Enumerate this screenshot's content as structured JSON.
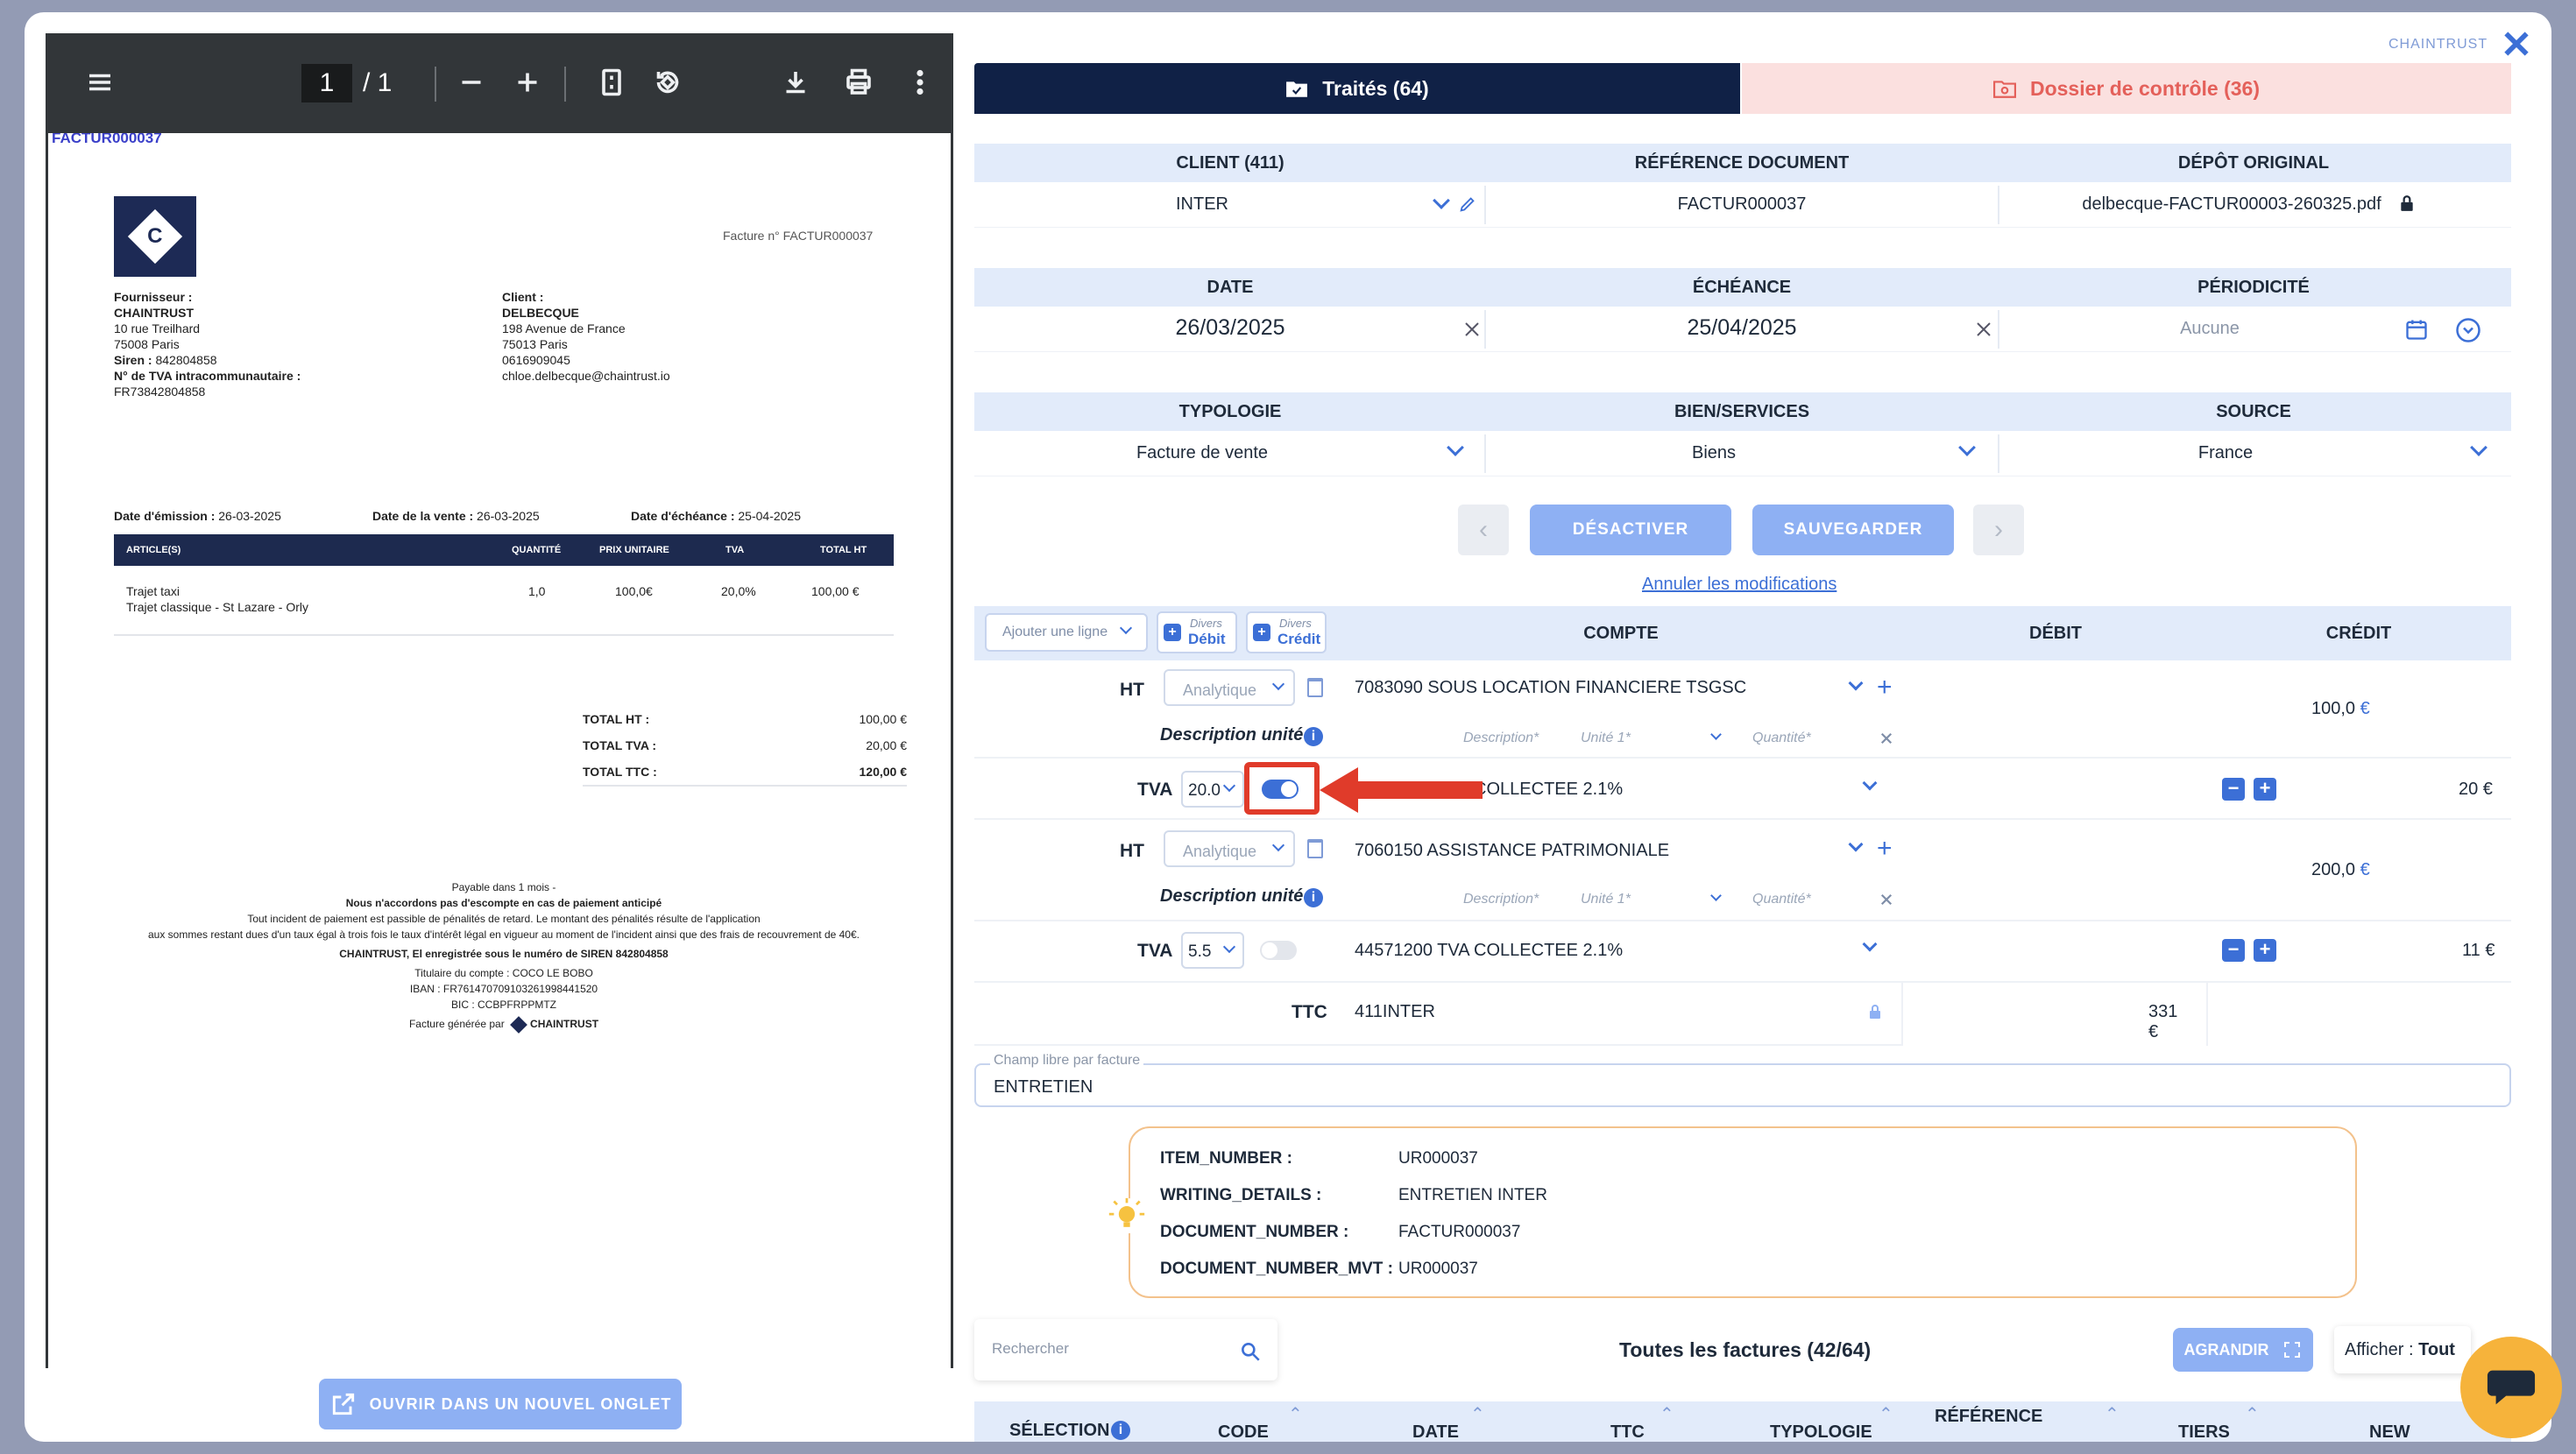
{
  "pdf": {
    "page_current": "1",
    "page_total": "1",
    "invoice_tag": "FACTUR000037",
    "invoice_title": "Facture n° FACTUR000037",
    "supplier_label": "Fournisseur :",
    "supplier_name": "CHAINTRUST",
    "supplier_addr1": "10 rue Treilhard",
    "supplier_addr2": "75008 Paris",
    "supplier_siren_label": "Siren :",
    "supplier_siren": "842804858",
    "supplier_vat_label": "N° de TVA intracommunautaire :",
    "supplier_vat": "FR73842804858",
    "client_label": "Client :",
    "client_name": "DELBECQUE",
    "client_addr1": "198 Avenue de France",
    "client_addr2": "75013 Paris",
    "client_phone": "0616909045",
    "client_email": "chloe.delbecque@chaintrust.io",
    "date_emission_label": "Date d'émission :",
    "date_emission": "26-03-2025",
    "date_vente_label": "Date de la vente :",
    "date_vente": "26-03-2025",
    "date_echeance_label": "Date d'échéance :",
    "date_echeance": "25-04-2025",
    "table_headers": [
      "ARTICLE(S)",
      "QUANTITÉ",
      "PRIX UNITAIRE",
      "TVA",
      "TOTAL HT"
    ],
    "item_line1": "Trajet taxi",
    "item_line2": "Trajet classique - St Lazare - Orly",
    "item_qty": "1,0",
    "item_price": "100,0€",
    "item_tva": "20,0%",
    "item_total": "100,00 €",
    "total_ht_label": "TOTAL HT :",
    "total_ht": "100,00 €",
    "total_tva_label": "TOTAL TVA :",
    "total_tva": "20,00 €",
    "total_ttc_label": "TOTAL TTC :",
    "total_ttc": "120,00 €",
    "footer1": "Payable dans 1 mois -",
    "footer2": "Nous n'accordons pas d'escompte en cas de paiement anticipé",
    "footer3": "Tout incident de paiement est passible de pénalités de retard. Le montant des pénalités résulte de l'application",
    "footer4": "aux sommes restant dues d'un taux égal à trois fois le taux d'intérêt légal en vigueur au moment de l'incident ainsi que des frais de recouvrement de 40€.",
    "footer5": "CHAINTRUST, El enregistrée sous le numéro de SIREN 842804858",
    "footer6": "Titulaire du compte : COCO LE BOBO",
    "footer7": "IBAN : FR7614707091032619984415​20",
    "footer8": "BIC : CCBPFRPPMTZ",
    "footer9": "Facture générée par",
    "footer_brand": "CHAINTRUST",
    "open_tab_button": "OUVRIR DANS UN NOUVEL ONGLET"
  },
  "header": {
    "brand": "CHAINTRUST",
    "tab_processed": "Traités (64)",
    "tab_control": "Dossier de contrôle (36)"
  },
  "meta": {
    "h_client": "CLIENT (411)",
    "h_ref": "RÉFÉRENCE DOCUMENT",
    "h_depot": "DÉPÔT ORIGINAL",
    "client": "INTER",
    "ref": "FACTUR000037",
    "depot": "delbecque-FACTUR00003-260325.pdf",
    "h_date": "DATE",
    "h_echeance": "ÉCHÉANCE",
    "h_periodicite": "PÉRIODICITÉ",
    "date": "26/03/2025",
    "echeance": "25/04/2025",
    "periodicite": "Aucune",
    "h_typologie": "TYPOLOGIE",
    "h_bien": "BIEN/SERVICES",
    "h_source": "SOURCE",
    "typologie": "Facture de vente",
    "bien": "Biens",
    "source": "France"
  },
  "actions": {
    "desactiver": "DÉSACTIVER",
    "sauvegarder": "SAUVEGARDER",
    "annuler": "Annuler les modifications"
  },
  "grid": {
    "add_line": "Ajouter une ligne",
    "divers": "Divers",
    "debit_btn": "Débit",
    "credit_btn": "Crédit",
    "h_compte": "COMPTE",
    "h_debit": "DÉBIT",
    "h_credit": "CRÉDIT",
    "analytique": "Analytique",
    "desc_unite": "Description unité",
    "ph_description": "Description*",
    "ph_unite": "Unité 1*",
    "ph_quantite": "Quantité*",
    "ht_label": "HT",
    "tva_label": "TVA",
    "ttc_label": "TTC",
    "row1_account": "7083090 SOUS LOCATION FINANCIERE TSGSC",
    "row1_credit": "100,0",
    "row2_rate": "20.0",
    "row2_account": "44571200 TVA COLLECTEE 2.1%",
    "row2_credit": "20 €",
    "row3_account": "7060150 ASSISTANCE PATRIMONIALE",
    "row3_credit": "200,0",
    "row4_rate": "5.5",
    "row4_account": "44571200 TVA COLLECTEE 2.1%",
    "row4_credit": "11 €",
    "ttc_account": "411INTER",
    "ttc_debit": "331 €",
    "euro": "€"
  },
  "free_field": {
    "label": "Champ libre par facture",
    "value": "ENTRETIEN"
  },
  "info": {
    "k1": "ITEM_NUMBER :",
    "v1": "UR000037",
    "k2": "WRITING_DETAILS :",
    "v2": "ENTRETIEN INTER",
    "k3": "DOCUMENT_NUMBER :",
    "v3": "FACTUR000037",
    "k4": "DOCUMENT_NUMBER_MVT :",
    "v4": "UR000037"
  },
  "list": {
    "search_placeholder": "Rechercher",
    "title": "Toutes les factures (42/64)",
    "agrandir": "AGRANDIR",
    "afficher_label": "Afficher :",
    "afficher_value": "Tout",
    "columns": [
      "SÉLECTION",
      "CODE",
      "DATE",
      "TTC",
      "TYPOLOGIE",
      "RÉFÉRENCE",
      "TIERS",
      "NEW"
    ]
  },
  "colors": {
    "navy": "#102146",
    "accent": "#3c6fd6",
    "highlight_red": "#e03b2a",
    "chat_button": "#f6b33b"
  }
}
